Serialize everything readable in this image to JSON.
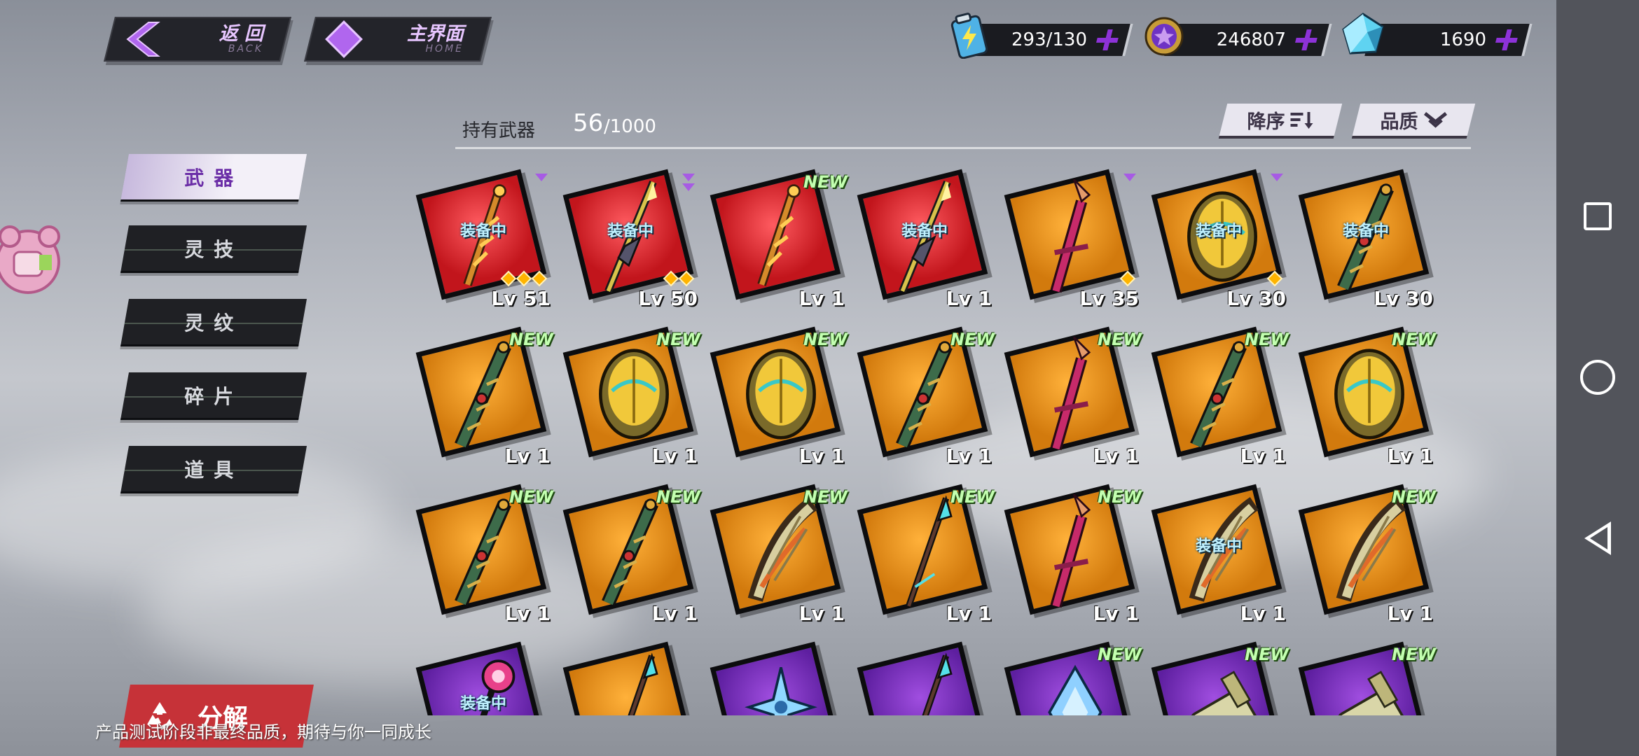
{
  "topbar": {
    "back": {
      "label": "返 回",
      "sub": "BACK"
    },
    "home": {
      "label": "主界面",
      "sub": "HOME"
    },
    "resources": [
      {
        "icon": "energy-battery-icon",
        "value": "293/130"
      },
      {
        "icon": "gold-coin-icon",
        "value": "246807"
      },
      {
        "icon": "crystal-gem-icon",
        "value": "1690"
      }
    ]
  },
  "sidebar": {
    "tabs": [
      {
        "label": "武器",
        "active": true
      },
      {
        "label": "灵技",
        "active": false
      },
      {
        "label": "灵纹",
        "active": false
      },
      {
        "label": "碎片",
        "active": false
      },
      {
        "label": "道具",
        "active": false
      }
    ],
    "decompose_label": "分解"
  },
  "inventory": {
    "count_label": "持有武器",
    "count": "56",
    "max": "/1000",
    "sort_label": "降序",
    "filter_label": "品质",
    "equipped_text": "装备中",
    "new_text": "NEW",
    "items": [
      {
        "bg": "red",
        "weapon": "chain-sword",
        "equipped": true,
        "new": false,
        "level": "Lv 51",
        "stars": 3,
        "arrows": 1
      },
      {
        "bg": "red",
        "weapon": "spiked-lance",
        "equipped": true,
        "new": false,
        "level": "Lv 50",
        "stars": 2,
        "arrows": 2
      },
      {
        "bg": "red",
        "weapon": "chain-sword",
        "equipped": false,
        "new": true,
        "level": "Lv 1",
        "stars": 0,
        "arrows": 0
      },
      {
        "bg": "red",
        "weapon": "spiked-lance",
        "equipped": true,
        "new": false,
        "level": "Lv 1",
        "stars": 0,
        "arrows": 0
      },
      {
        "bg": "orange",
        "weapon": "crimson-blade",
        "equipped": false,
        "new": false,
        "level": "Lv 35",
        "stars": 1,
        "arrows": 1
      },
      {
        "bg": "orange",
        "weapon": "golden-shield",
        "equipped": true,
        "new": false,
        "level": "Lv 30",
        "stars": 1,
        "arrows": 1
      },
      {
        "bg": "orange",
        "weapon": "jade-gauntlet",
        "equipped": true,
        "new": false,
        "level": "Lv 30",
        "stars": 0,
        "arrows": 0
      },
      {
        "bg": "orange",
        "weapon": "jade-gauntlet",
        "equipped": false,
        "new": true,
        "level": "Lv 1",
        "stars": 0,
        "arrows": 0
      },
      {
        "bg": "orange",
        "weapon": "golden-shield",
        "equipped": false,
        "new": true,
        "level": "Lv 1",
        "stars": 0,
        "arrows": 0
      },
      {
        "bg": "orange",
        "weapon": "golden-shield",
        "equipped": false,
        "new": true,
        "level": "Lv 1",
        "stars": 0,
        "arrows": 0
      },
      {
        "bg": "orange",
        "weapon": "jade-gauntlet",
        "equipped": false,
        "new": true,
        "level": "Lv 1",
        "stars": 0,
        "arrows": 0
      },
      {
        "bg": "orange",
        "weapon": "crimson-blade",
        "equipped": false,
        "new": true,
        "level": "Lv 1",
        "stars": 0,
        "arrows": 0
      },
      {
        "bg": "orange",
        "weapon": "jade-gauntlet",
        "equipped": false,
        "new": true,
        "level": "Lv 1",
        "stars": 0,
        "arrows": 0
      },
      {
        "bg": "orange",
        "weapon": "golden-shield",
        "equipped": false,
        "new": true,
        "level": "Lv 1",
        "stars": 0,
        "arrows": 0
      },
      {
        "bg": "orange",
        "weapon": "jade-gauntlet",
        "equipped": false,
        "new": true,
        "level": "Lv 1",
        "stars": 0,
        "arrows": 0
      },
      {
        "bg": "orange",
        "weapon": "jade-gauntlet",
        "equipped": false,
        "new": true,
        "level": "Lv 1",
        "stars": 0,
        "arrows": 0
      },
      {
        "bg": "orange",
        "weapon": "feather-claw",
        "equipped": false,
        "new": true,
        "level": "Lv 1",
        "stars": 0,
        "arrows": 0
      },
      {
        "bg": "orange",
        "weapon": "teal-spear",
        "equipped": false,
        "new": true,
        "level": "Lv 1",
        "stars": 0,
        "arrows": 0
      },
      {
        "bg": "orange",
        "weapon": "crimson-blade",
        "equipped": false,
        "new": true,
        "level": "Lv 1",
        "stars": 0,
        "arrows": 0
      },
      {
        "bg": "orange",
        "weapon": "feather-claw",
        "equipped": true,
        "new": false,
        "level": "Lv 1",
        "stars": 0,
        "arrows": 0
      },
      {
        "bg": "orange",
        "weapon": "feather-claw",
        "equipped": false,
        "new": true,
        "level": "Lv 1",
        "stars": 0,
        "arrows": 0
      },
      {
        "bg": "purple",
        "weapon": "rose-staff",
        "equipped": true,
        "new": false,
        "level": "",
        "stars": 0,
        "arrows": 0
      },
      {
        "bg": "orange",
        "weapon": "teal-spear",
        "equipped": false,
        "new": false,
        "level": "",
        "stars": 0,
        "arrows": 0
      },
      {
        "bg": "purple",
        "weapon": "ice-shuriken",
        "equipped": false,
        "new": false,
        "level": "",
        "stars": 0,
        "arrows": 0
      },
      {
        "bg": "purple",
        "weapon": "teal-spear",
        "equipped": false,
        "new": false,
        "level": "",
        "stars": 0,
        "arrows": 0
      },
      {
        "bg": "purple",
        "weapon": "ice-crystal",
        "equipped": false,
        "new": true,
        "level": "",
        "stars": 0,
        "arrows": 0
      },
      {
        "bg": "purple",
        "weapon": "bone-cannon",
        "equipped": false,
        "new": true,
        "level": "",
        "stars": 0,
        "arrows": 0
      },
      {
        "bg": "purple",
        "weapon": "bone-cannon",
        "equipped": false,
        "new": true,
        "level": "",
        "stars": 0,
        "arrows": 0
      }
    ]
  },
  "footer_note": "产品测试阶段非最终品质，期待与你一同成长",
  "colors": {
    "accent": "#8d32d8",
    "red_tile": "#d41e26",
    "orange_tile": "#f29a1a",
    "purple_tile": "#7a2cc2",
    "decompose": "#c63238"
  }
}
